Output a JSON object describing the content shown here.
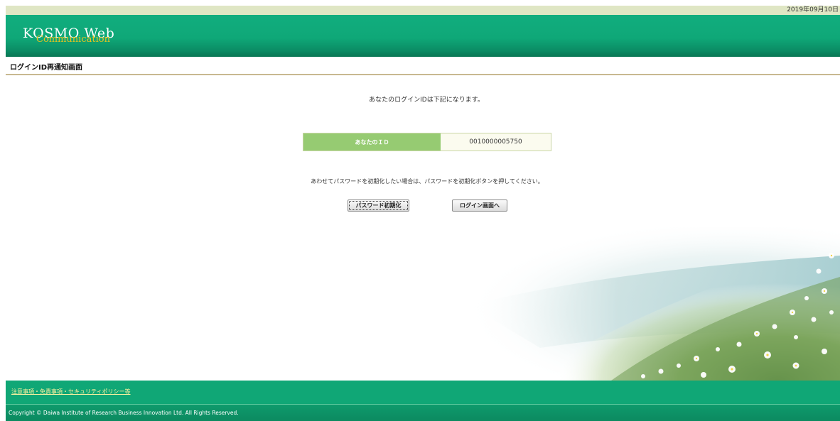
{
  "topbar": {
    "date": "2019年09月10日"
  },
  "header": {
    "logo_main": "KOSMO Web",
    "logo_sub": "Communication"
  },
  "page": {
    "title": "ログインID再通知画面"
  },
  "main": {
    "intro": "あなたのログインIDは下記になります。",
    "id_label": "あなたのＩＤ",
    "id_value": "0010000005750",
    "note": "あわせてパスワードを初期化したい場合は、パスワードを初期化ボタンを押してください。",
    "reset_button": "パスワード初期化",
    "login_button": "ログイン画面へ"
  },
  "footer": {
    "links": "注意事項・免責事項・セキュリティポリシー等",
    "copyright": "Copyright © Daiwa Institute of Research Business Innovation Ltd. All Rights Reserved."
  },
  "colors": {
    "header_green": "#10a776",
    "id_label_green": "#96cb72",
    "link_yellow": "#fff3a0"
  }
}
